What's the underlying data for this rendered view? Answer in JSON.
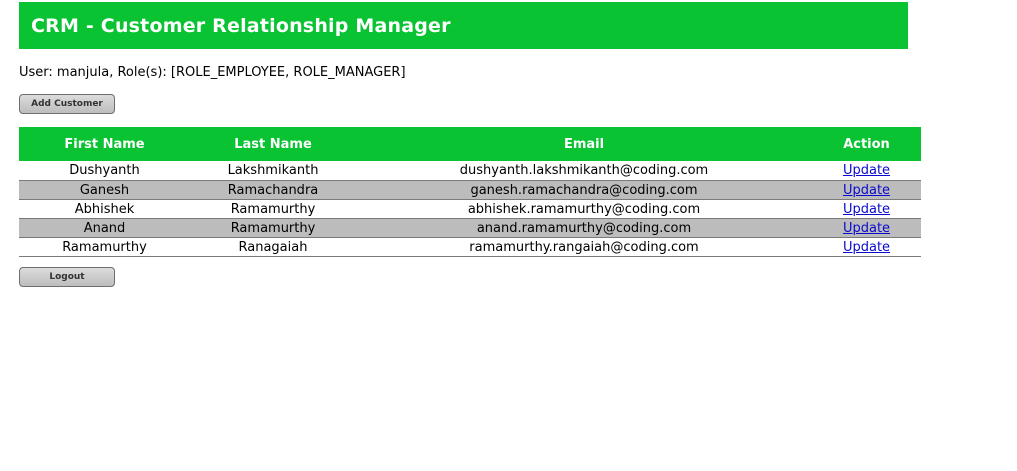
{
  "header": {
    "title": "CRM - Customer Relationship Manager"
  },
  "user_info": "User: manjula, Role(s): [ROLE_EMPLOYEE, ROLE_MANAGER]",
  "buttons": {
    "add_customer": "Add Customer",
    "logout": "Logout"
  },
  "table": {
    "headers": [
      "First Name",
      "Last Name",
      "Email",
      "Action"
    ],
    "rows": [
      {
        "first": "Dushyanth",
        "last": "Lakshmikanth",
        "email": "dushyanth.lakshmikanth@coding.com",
        "action": "Update"
      },
      {
        "first": "Ganesh",
        "last": "Ramachandra",
        "email": "ganesh.ramachandra@coding.com",
        "action": "Update"
      },
      {
        "first": "Abhishek",
        "last": "Ramamurthy",
        "email": "abhishek.ramamurthy@coding.com",
        "action": "Update"
      },
      {
        "first": "Anand",
        "last": "Ramamurthy",
        "email": "anand.ramamurthy@coding.com",
        "action": "Update"
      },
      {
        "first": "Ramamurthy",
        "last": "Ranagaiah",
        "email": "ramamurthy.rangaiah@coding.com",
        "action": "Update"
      }
    ]
  },
  "colors": {
    "header_green": "#09c332",
    "alt_row": "#bcbcbc",
    "link": "#0a0acc"
  }
}
